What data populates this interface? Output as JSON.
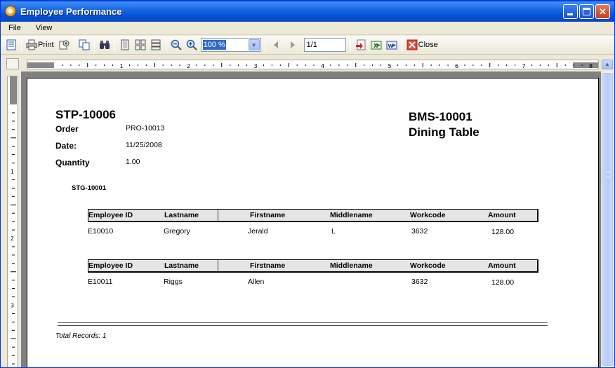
{
  "window": {
    "title": "Employee Performance"
  },
  "menu": {
    "items": [
      "File",
      "View"
    ]
  },
  "toolbar": {
    "print_label": "Print",
    "zoom_value": "100 %",
    "page_value": "1/1",
    "close_label": "Close"
  },
  "ruler": {
    "h_numbers": [
      "1",
      "2",
      "3",
      "4",
      "5",
      "6",
      "7",
      "8"
    ],
    "v_numbers": [
      "1",
      "2",
      "3"
    ]
  },
  "report": {
    "header_left_id": "STP-10006",
    "order_label": "Order",
    "order_value": "PRO-10013",
    "date_label": "Date:",
    "date_value": "11/25/2008",
    "quantity_label": "Quantity",
    "quantity_value": "1.00",
    "header_right_id": "BMS-10001",
    "header_right_name": "Dining Table",
    "group_label": "STG-10001",
    "columns": [
      "Employee ID",
      "Lastname",
      "Firstname",
      "Middlename",
      "Workcode",
      "Amount"
    ],
    "rows": [
      {
        "employee_id": "E10010",
        "lastname": "Gregory",
        "firstname": "Jerald",
        "middlename": "L",
        "workcode": "3632",
        "amount": "128.00"
      },
      {
        "employee_id": "E10011",
        "lastname": "Riggs",
        "firstname": "Allen",
        "middlename": "",
        "workcode": "3632",
        "amount": "128.00"
      }
    ],
    "total_records": "Total Records:  1"
  }
}
